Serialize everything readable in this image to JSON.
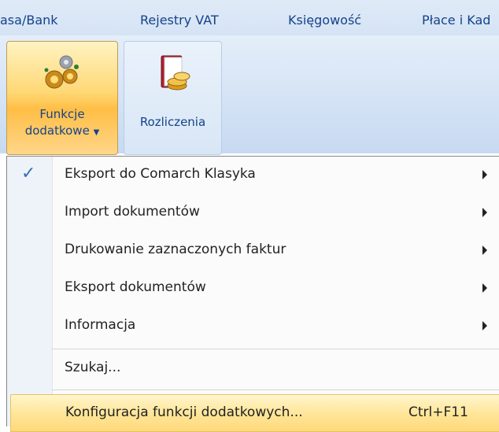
{
  "tabs": [
    "asa/Bank",
    "Rejestry VAT",
    "Księgowość",
    "Płace i Kad"
  ],
  "ribbon": {
    "funkcje": {
      "line1": "Funkcje",
      "line2": "dodatkowe",
      "icon": "gears-icon"
    },
    "rozliczenia": {
      "label": "Rozliczenia",
      "icon": "ledger-coins-icon"
    }
  },
  "menu": {
    "items": [
      {
        "label": "Eksport do Comarch Klasyka",
        "checked": true,
        "submenu": true
      },
      {
        "label": "Import dokumentów",
        "submenu": true
      },
      {
        "label": "Drukowanie zaznaczonych faktur",
        "submenu": true
      },
      {
        "label": "Eksport dokumentów",
        "submenu": true
      },
      {
        "label": "Informacja",
        "submenu": true
      },
      {
        "label": "Szukaj..."
      },
      {
        "label": "Konfiguracja funkcji dodatkowych...",
        "shortcut": "Ctrl+F11",
        "highlighted": true
      }
    ]
  },
  "colors": {
    "accent": "#15428b",
    "highlight": "#ffe69a",
    "check": "#3a6fb5"
  }
}
